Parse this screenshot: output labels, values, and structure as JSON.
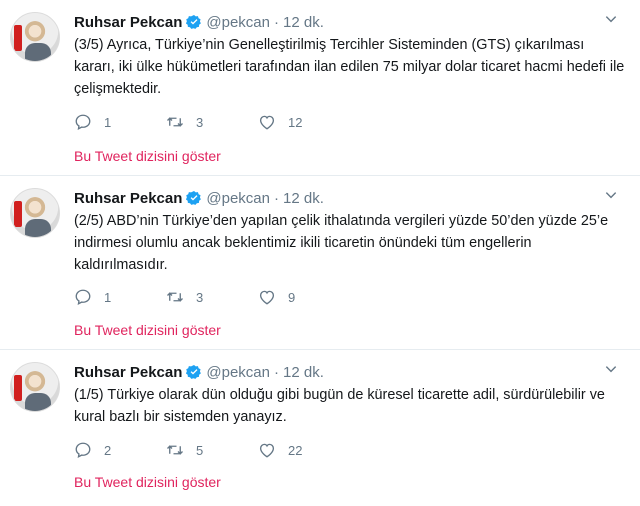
{
  "tweets": [
    {
      "name": "Ruhsar Pekcan",
      "handle": "@pekcan",
      "separator": "·",
      "time": "12 dk.",
      "text": "(3/5) Ayrıca, Türkiye’nin Genelleştirilmiş Tercihler Sisteminden (GTS) çıkarılması kararı, iki ülke hükümetleri tarafından ilan edilen 75 milyar dolar ticaret hacmi hedefi ile çelişmektedir.",
      "replies": "1",
      "retweets": "3",
      "likes": "12",
      "thread_link": "Bu Tweet dizisini göster"
    },
    {
      "name": "Ruhsar Pekcan",
      "handle": "@pekcan",
      "separator": "·",
      "time": "12 dk.",
      "text": "(2/5) ABD’nin Türkiye’den yapılan çelik ithalatında vergileri yüzde 50’den yüzde 25’e indirmesi olumlu ancak beklentimiz ikili ticaretin önündeki tüm engellerin kaldırılmasıdır.",
      "replies": "1",
      "retweets": "3",
      "likes": "9",
      "thread_link": "Bu Tweet dizisini göster"
    },
    {
      "name": "Ruhsar Pekcan",
      "handle": "@pekcan",
      "separator": "·",
      "time": "12 dk.",
      "text": "(1/5) Türkiye olarak dün olduğu gibi bugün de küresel ticarette adil, sürdürülebilir ve kural bazlı bir sistemden yanayız.",
      "replies": "2",
      "retweets": "5",
      "likes": "22",
      "thread_link": "Bu Tweet dizisini göster"
    }
  ],
  "icons": {
    "verified": "verified-badge-icon",
    "caret": "chevron-down-icon",
    "reply": "reply-icon",
    "retweet": "retweet-icon",
    "like": "heart-icon"
  },
  "colors": {
    "text": "#14171a",
    "muted": "#657786",
    "verified": "#1da1f2",
    "thread_link": "#e0245e",
    "divider": "#e6ecf0"
  }
}
